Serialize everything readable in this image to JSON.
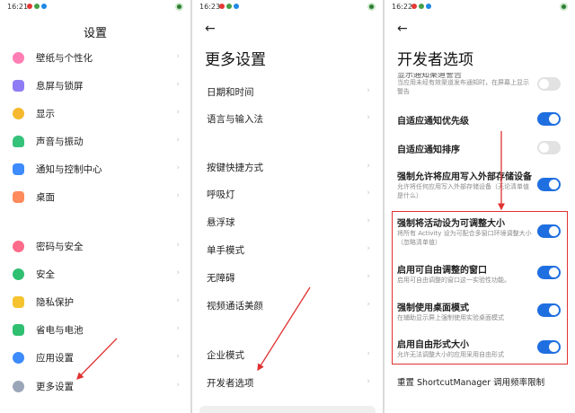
{
  "colors": {
    "toggle_on": "#1f6fe0",
    "toggle_off": "#e2e2e2",
    "annotation": "#e03030",
    "highlight_border": "#e03030"
  },
  "panel1": {
    "status_time": "16:21",
    "title": "设置",
    "items": [
      {
        "label": "壁纸与个性化",
        "icon": "wallpaper-icon",
        "color": "#ff7eb3"
      },
      {
        "label": "息屏与锁屏",
        "icon": "lock-screen-icon",
        "color": "#8e7cf5"
      },
      {
        "label": "显示",
        "icon": "display-icon",
        "color": "#f5b82e"
      },
      {
        "label": "声音与振动",
        "icon": "sound-icon",
        "color": "#35c27a"
      },
      {
        "label": "通知与控制中心",
        "icon": "notification-icon",
        "color": "#3d8bfd"
      },
      {
        "label": "桌面",
        "icon": "desktop-icon",
        "color": "#ff8a5b"
      },
      {
        "label": "密码与安全",
        "icon": "password-icon",
        "color": "#ff6b8a"
      },
      {
        "label": "安全",
        "icon": "security-icon",
        "color": "#2fbf71"
      },
      {
        "label": "隐私保护",
        "icon": "privacy-icon",
        "color": "#f5c32e"
      },
      {
        "label": "省电与电池",
        "icon": "battery-icon",
        "color": "#2fbf71"
      },
      {
        "label": "应用设置",
        "icon": "app-settings-icon",
        "color": "#3d8bfd"
      },
      {
        "label": "更多设置",
        "icon": "more-settings-icon",
        "color": "#9aa6b8"
      }
    ]
  },
  "panel2": {
    "status_time": "16:23",
    "title": "更多设置",
    "items": [
      {
        "label": "日期和时间"
      },
      {
        "label": "语言与输入法"
      },
      {
        "label": "按键快捷方式"
      },
      {
        "label": "呼吸灯"
      },
      {
        "label": "悬浮球"
      },
      {
        "label": "单手模式"
      },
      {
        "label": "无障碍"
      },
      {
        "label": "视频通话美颜"
      },
      {
        "label": "企业模式"
      },
      {
        "label": "开发者选项"
      }
    ]
  },
  "panel3": {
    "status_time": "16:22",
    "title": "开发者选项",
    "cut_title": "显示通知渠道警告",
    "items": [
      {
        "label": "",
        "desc": "当应用未经有效渠道发布通知时，在屏幕上显示警告",
        "toggle": "off"
      },
      {
        "label": "自适应通知优先级",
        "desc": "",
        "toggle": "on"
      },
      {
        "label": "自适应通知排序",
        "desc": "",
        "toggle": "off"
      },
      {
        "label": "强制允许将应用写入外部存储设备",
        "desc": "允许将任何应用写入外部存储设备（无论清单值是什么）",
        "toggle": "on"
      },
      {
        "label": "强制将活动设为可调整大小",
        "desc": "将所有 Activity 设为可配合多窗口环境调整大小（忽略清单值）",
        "toggle": "on"
      },
      {
        "label": "启用可自由调整的窗口",
        "desc": "启用可自由调整的窗口这一实验性功能。",
        "toggle": "on"
      },
      {
        "label": "强制使用桌面模式",
        "desc": "在辅助显示屏上强制使用实验桌面模式",
        "toggle": "on"
      },
      {
        "label": "启用自由形式大小",
        "desc": "允许无法调整大小的应用采用自由形式",
        "toggle": "on"
      }
    ],
    "bottom_item": "重置 ShortcutManager 调用频率限制"
  }
}
